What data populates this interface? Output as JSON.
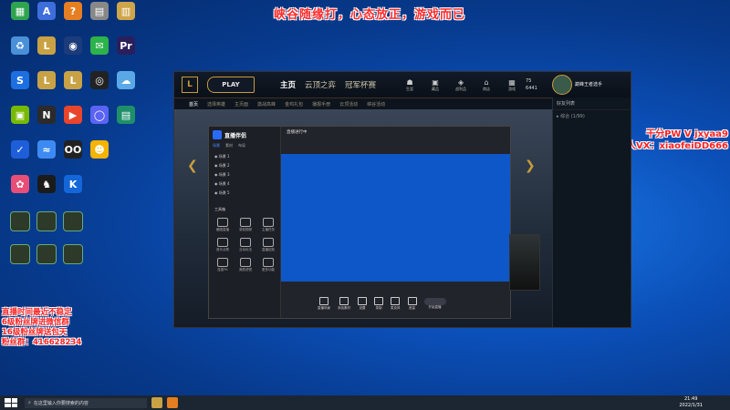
{
  "overlay": {
    "top_text": "峡谷随缘打，心态放正，游戏而已",
    "right_line1": "干分PW V jxyaa9",
    "right_line2": "本人VX：xiaofeiDD666",
    "left_lines": [
      "直播时间最近不稳定",
      "6级粉丝牌进微信群",
      "16级粉丝牌送包天",
      "粉丝群：416628234"
    ]
  },
  "desktop_icons": [
    {
      "label": "",
      "color": "#2ea44f",
      "glyph": "▦"
    },
    {
      "label": "",
      "color": "#3e6edc",
      "glyph": "A"
    },
    {
      "label": "",
      "color": "#e67e22",
      "glyph": "?"
    },
    {
      "label": "",
      "color": "#888888",
      "glyph": "▤"
    },
    {
      "label": "",
      "color": "#cfa54a",
      "glyph": "▥"
    },
    {
      "label": "",
      "color": "#4a90d9",
      "glyph": "♻"
    },
    {
      "label": "",
      "color": "#c8a245",
      "glyph": "L"
    },
    {
      "label": "",
      "color": "#1c3b7a",
      "glyph": "◉"
    },
    {
      "label": "",
      "color": "#2cb34a",
      "glyph": "✉"
    },
    {
      "label": "",
      "color": "#2a1f5c",
      "glyph": "Pr"
    },
    {
      "label": "",
      "color": "#1d6fe0",
      "glyph": "S"
    },
    {
      "label": "",
      "color": "#c8a245",
      "glyph": "L"
    },
    {
      "label": "",
      "color": "#c8a245",
      "glyph": "L"
    },
    {
      "label": "",
      "color": "#222222",
      "glyph": "◎"
    },
    {
      "label": "",
      "color": "#5aa9e6",
      "glyph": "☁"
    },
    {
      "label": "",
      "color": "#76b900",
      "glyph": "▣"
    },
    {
      "label": "",
      "color": "#2b2b2b",
      "glyph": "N"
    },
    {
      "label": "",
      "color": "#e8452c",
      "glyph": "▶"
    },
    {
      "label": "",
      "color": "#5b63f5",
      "glyph": "◯"
    },
    {
      "label": "",
      "color": "#1f8f6a",
      "glyph": "▤"
    },
    {
      "label": "",
      "color": "#1e5fd9",
      "glyph": "✓"
    },
    {
      "label": "",
      "color": "#3d8bf2",
      "glyph": "≈"
    },
    {
      "label": "",
      "color": "#222222",
      "glyph": "OO"
    },
    {
      "label": "",
      "color": "#f5b400",
      "glyph": "☻"
    },
    {
      "label": "",
      "color": "#e94e77",
      "glyph": "✿"
    },
    {
      "label": "",
      "color": "#1b1b1b",
      "glyph": "♞"
    },
    {
      "label": "",
      "color": "#1467d8",
      "glyph": "K"
    }
  ],
  "lol": {
    "play_label": "PLAY",
    "nav": [
      "主页",
      "云顶之弈",
      "冠军杯赛"
    ],
    "top_icons": [
      "生涯",
      "藏品",
      "战利品",
      "商店",
      "游戏"
    ],
    "currency": {
      "be": "75",
      "rp": "6441"
    },
    "player_name": "巅峰王者选手",
    "subnav": [
      "首页",
      "选择英雄",
      "主页面",
      "激战高峰",
      "金鸡礼包",
      "播报手册",
      "云顶活动",
      "峡谷活动"
    ],
    "friends_header": "好友列表",
    "friends_row": "▸ 综合 (1/99)"
  },
  "stream": {
    "app_name": "直播伴侣",
    "tabs": [
      "场景",
      "素材",
      "布局"
    ],
    "scenes": [
      "场景 1",
      "场景 2",
      "场景 3",
      "场景 4",
      "场景 5"
    ],
    "tools_header": "工具箱",
    "tools": [
      "截图直播",
      "录制视频",
      "主播任务",
      "音乐点歌",
      "互动玩法",
      "直播回放",
      "连麦PK",
      "美颜滤镜",
      "更多功能"
    ],
    "header_text": "直播进行中",
    "bottom_buttons": [
      "直播场景",
      "添加素材",
      "设置",
      "录制",
      "麦克风",
      "音量",
      "开始直播"
    ]
  },
  "taskbar": {
    "search_placeholder": "在这里输入你要搜索的内容",
    "time": "21:49",
    "date": "2022/1/31"
  }
}
